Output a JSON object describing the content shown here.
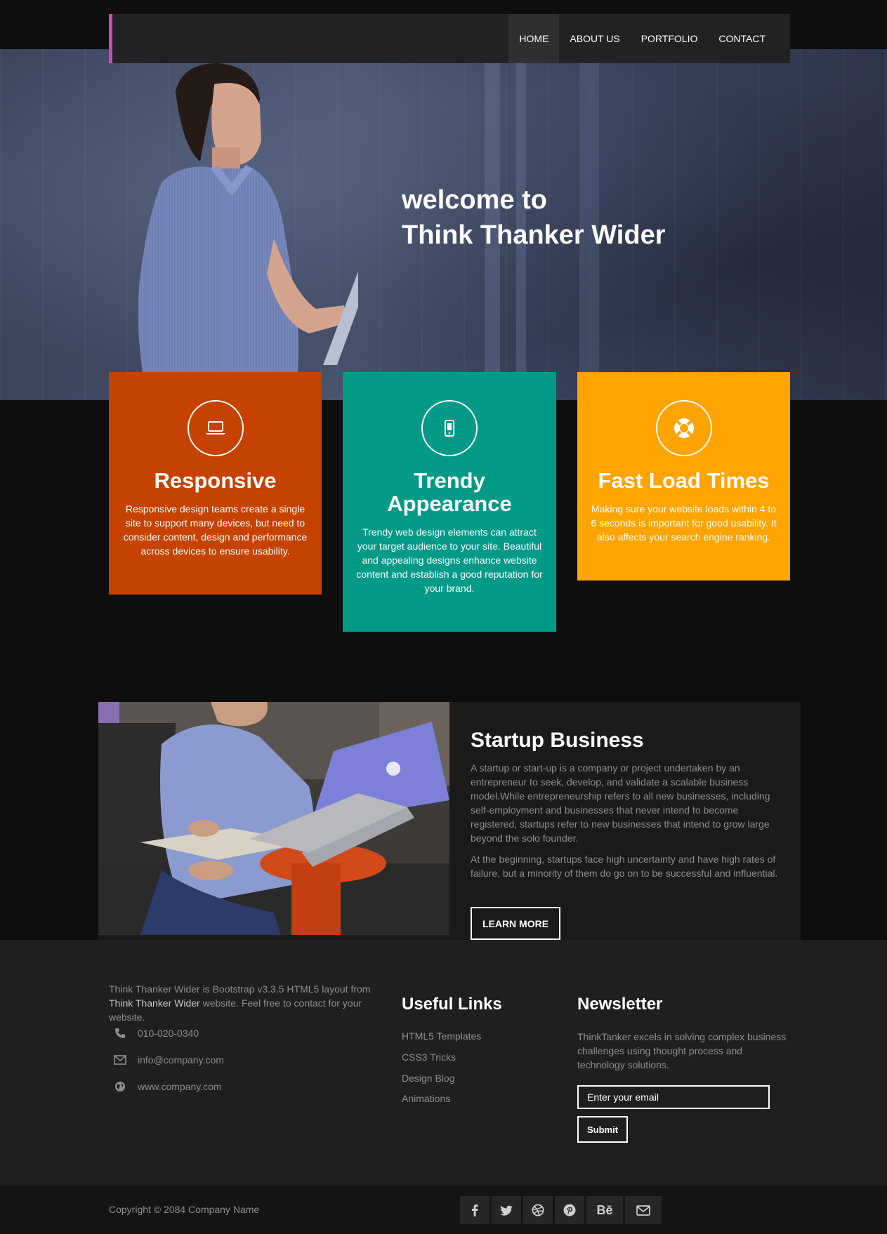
{
  "colors": {
    "nav_accent": "#c74fb2",
    "responsive_bg": "#c54200",
    "trendy_bg": "#009a87",
    "fast_bg": "#ffa400",
    "page_bg": "#0e0e0f",
    "footer_bg": "#1f1f20"
  },
  "nav": {
    "items": [
      "HOME",
      "ABOUT US",
      "PORTFOLIO",
      "CONTACT"
    ],
    "active": "HOME"
  },
  "hero": {
    "line1": "welcome to",
    "line2": "Think Thanker Wider"
  },
  "features": [
    {
      "icon": "laptop-icon",
      "title": "Responsive",
      "text": "Responsive design teams create a single site to support many devices, but need to consider content, design and performance across devices to ensure usability."
    },
    {
      "icon": "mobile-icon",
      "title": "Trendy Appearance",
      "text": "Trendy web design elements can attract your target audience to your site. Beautiful and appealing designs enhance website content and establish a good reputation for your brand."
    },
    {
      "icon": "lifebuoy-icon",
      "title": "Fast Load Times",
      "text": "Making sure your website loads within 4 to 6 seconds is important for good usability. It also affects your search engine ranking."
    }
  ],
  "startup": {
    "title": "Startup Business",
    "para1": "A startup or start-up is a company or project undertaken by an entrepreneur to seek, develop, and validate a scalable business model.While entrepreneurship refers to all new businesses, including self-employment and businesses that never intend to become registered, startups refer to new businesses that intend to grow large beyond the solo founder.",
    "para2": "At the beginning, startups face high uncertainty and have high rates of failure, but a minority of them do go on to be successful and influential.",
    "button": "LEARN MORE"
  },
  "footer": {
    "about_prefix": "Think Thanker Wider is Bootstrap v3.3.5 HTML5 layout from ",
    "about_brand": "Think Thanker Wider",
    "about_suffix": " website. Feel free to contact for your website.",
    "phone": "010-020-0340",
    "email": "info@company.com",
    "website": "www.company.com",
    "links_title": "Useful Links",
    "links": [
      "HTML5 Templates",
      "CSS3 Tricks",
      "Design Blog",
      "Animations"
    ],
    "newsletter_title": "Newsletter",
    "newsletter_text": "ThinkTanker excels in solving complex business challenges using thought process and technology solutions.",
    "email_placeholder": "Enter your email",
    "submit": "Submit"
  },
  "bottom": {
    "copyright": "Copyright © 2084 Company Name",
    "socials": [
      "facebook-icon",
      "twitter-icon",
      "dribbble-icon",
      "pinterest-icon",
      "behance-icon",
      "envelope-icon"
    ],
    "behance_label": "Bē"
  }
}
